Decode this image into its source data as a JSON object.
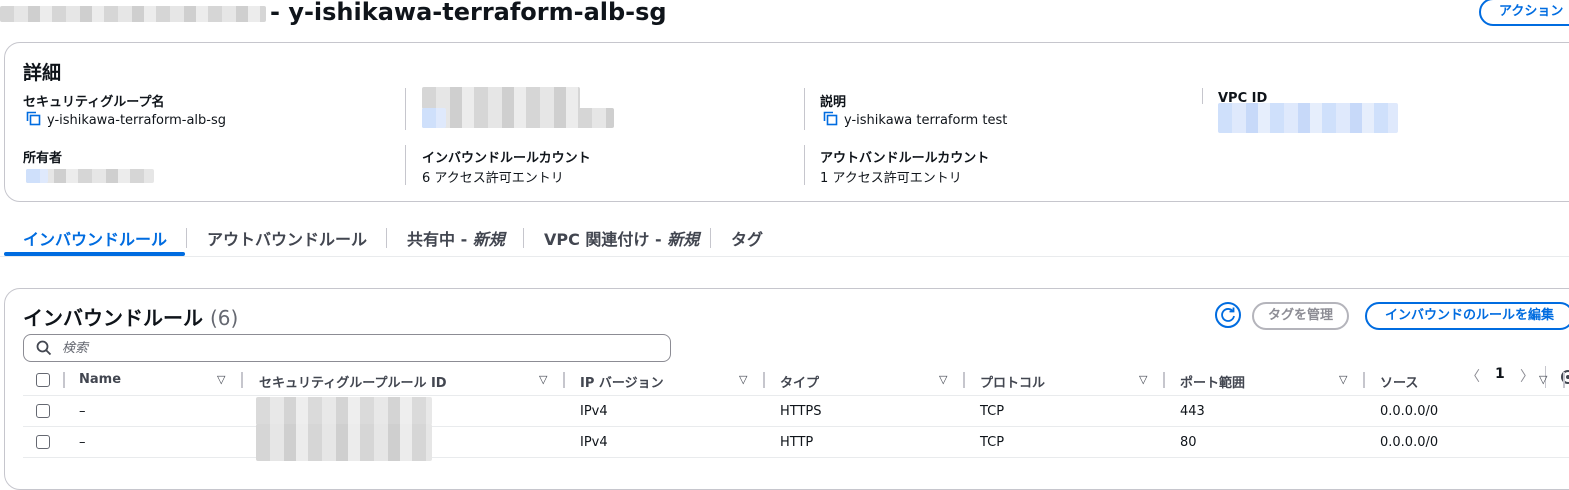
{
  "header": {
    "title": "- y-ishikawa-terraform-alb-sg",
    "action_button": "アクション"
  },
  "details": {
    "heading": "詳細",
    "fields": {
      "sg_name_label": "セキュリティグループ名",
      "sg_name_value": "y-ishikawa-terraform-alb-sg",
      "description_label": "説明",
      "description_value": "y-ishikawa terraform test",
      "vpc_id_label": "VPC ID",
      "owner_label": "所有者",
      "inbound_count_label": "インバウンドルールカウント",
      "inbound_count_value": "6 アクセス許可エントリ",
      "outbound_count_label": "アウトバンドルールカウント",
      "outbound_count_value": "1 アクセス許可エントリ"
    }
  },
  "tabs": {
    "inbound": "インバウンドルール",
    "outbound": "アウトバウンドルール",
    "sharing": "共有中 - ",
    "sharing_new": "新規",
    "vpc": "VPC 関連付け - ",
    "vpc_new": "新規",
    "tags": "タグ"
  },
  "rules": {
    "title": "インバウンドルール",
    "count": "(6)",
    "manage_tags_button": "タグを管理",
    "edit_button": "インバウンドのルールを編集",
    "search_placeholder": "検索",
    "page": "1",
    "columns": {
      "name": "Name",
      "rule_id": "セキュリティグループルール ID",
      "ip_version": "IP バージョン",
      "type": "タイプ",
      "protocol": "プロトコル",
      "port_range": "ポート範囲",
      "source": "ソース"
    },
    "rows": [
      {
        "name": "–",
        "ip_version": "IPv4",
        "type": "HTTPS",
        "protocol": "TCP",
        "port_range": "443",
        "source": "0.0.0.0/0"
      },
      {
        "name": "–",
        "ip_version": "IPv4",
        "type": "HTTP",
        "protocol": "TCP",
        "port_range": "80",
        "source": "0.0.0.0/0"
      }
    ]
  },
  "colors": {
    "accent": "#006ce0",
    "text": "#0f141a",
    "border": "#c6c6cd"
  }
}
